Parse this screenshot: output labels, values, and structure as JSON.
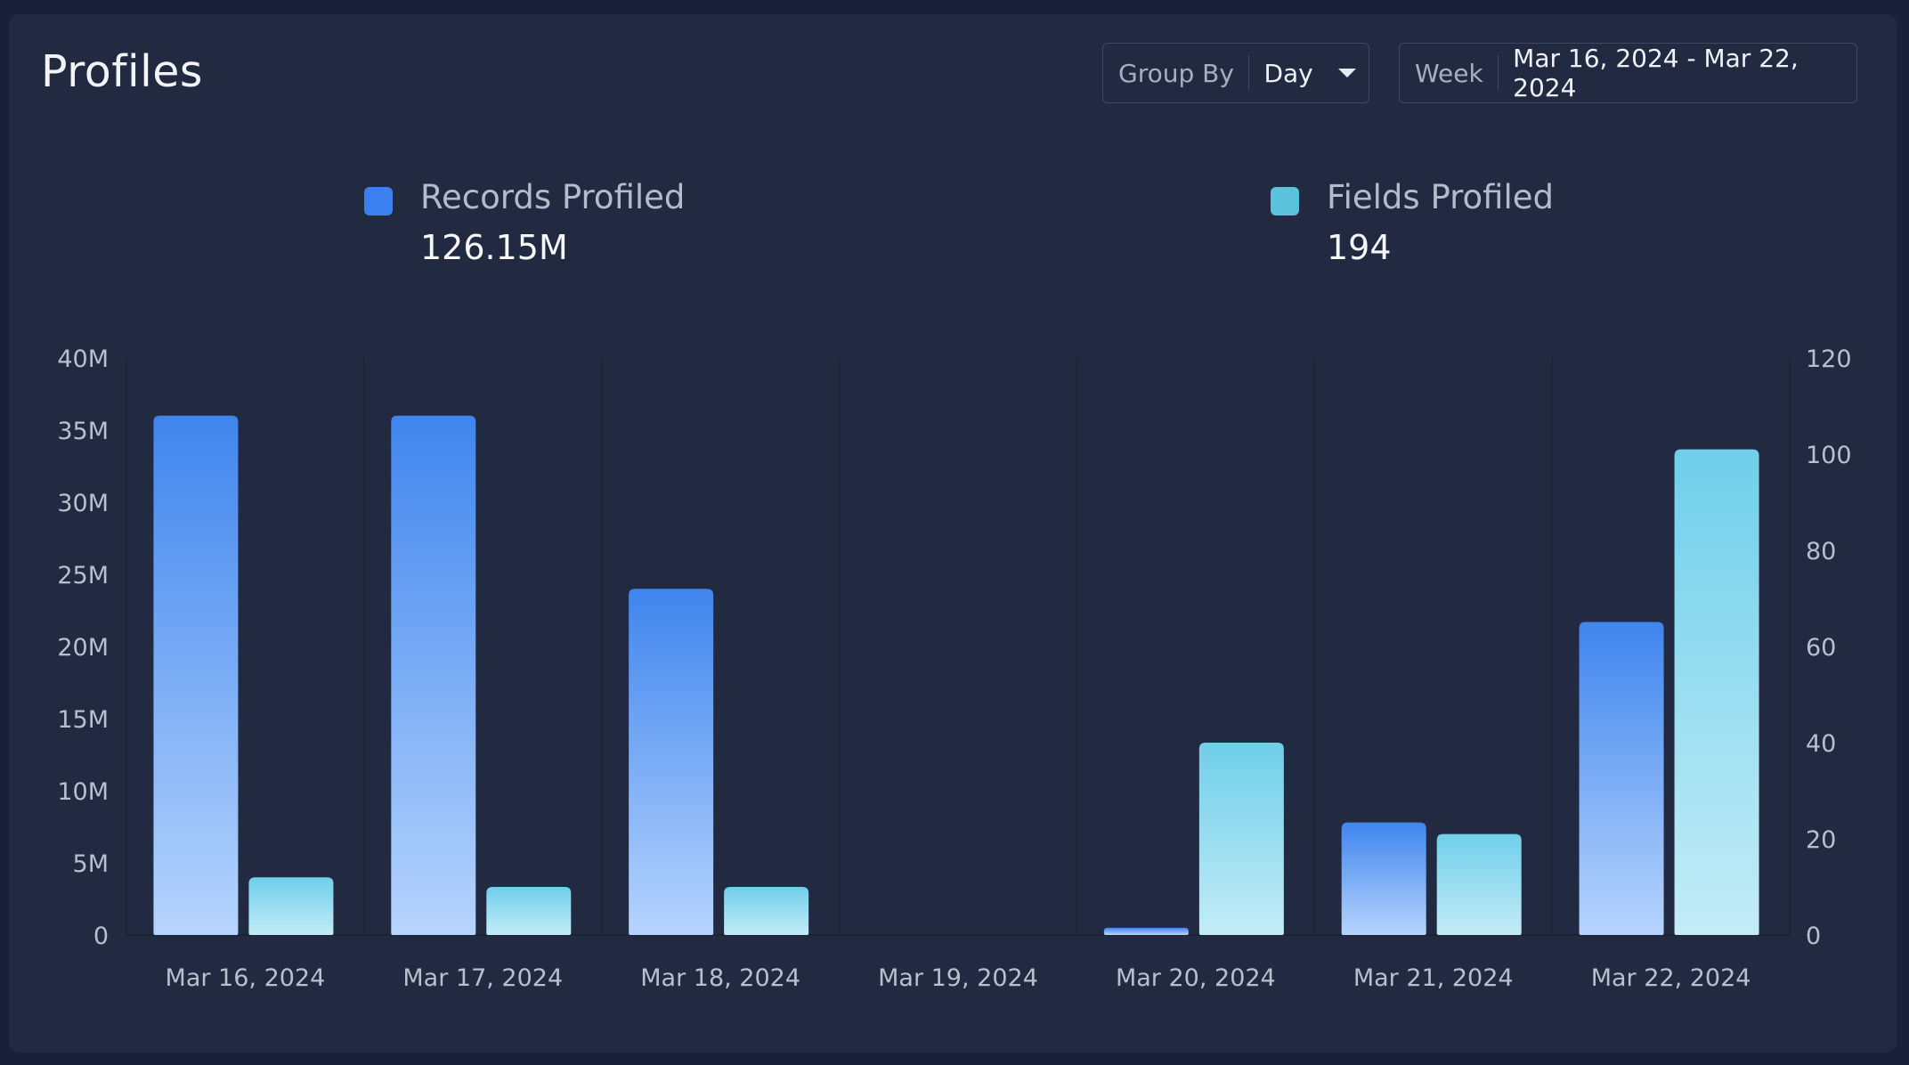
{
  "header": {
    "title": "Profiles",
    "group_by_label": "Group By",
    "group_by_value": "Day",
    "week_label": "Week",
    "week_value": "Mar 16, 2024 - Mar 22, 2024"
  },
  "legend": [
    {
      "name": "Records Profiled",
      "value": "126.15M",
      "color": "#3b7ff0"
    },
    {
      "name": "Fields Profiled",
      "value": "194",
      "color": "#5bc2dc"
    }
  ],
  "icons": {
    "group_by_caret": "chevron-down-icon"
  },
  "chart_data": {
    "type": "bar",
    "categories": [
      "Mar 16, 2024",
      "Mar 17, 2024",
      "Mar 18, 2024",
      "Mar 19, 2024",
      "Mar 20, 2024",
      "Mar 21, 2024",
      "Mar 22, 2024"
    ],
    "series": [
      {
        "name": "Records Profiled",
        "axis": "left",
        "values": [
          36000000,
          36000000,
          24000000,
          0,
          500000,
          7800000,
          21700000
        ],
        "color_top": "#3f85ee",
        "color_bottom": "#b6d4fd"
      },
      {
        "name": "Fields Profiled",
        "axis": "right",
        "values": [
          12,
          10,
          10,
          0,
          40,
          21,
          101
        ],
        "color_top": "#6fcfea",
        "color_bottom": "#c3ecf7"
      }
    ],
    "left_axis": {
      "min": 0,
      "max": 40000000,
      "ticks": [
        "0",
        "5M",
        "10M",
        "15M",
        "20M",
        "25M",
        "30M",
        "35M",
        "40M"
      ]
    },
    "right_axis": {
      "min": 0,
      "max": 120,
      "ticks": [
        "0",
        "20",
        "40",
        "60",
        "80",
        "100",
        "120"
      ]
    },
    "grid": "vertical"
  }
}
